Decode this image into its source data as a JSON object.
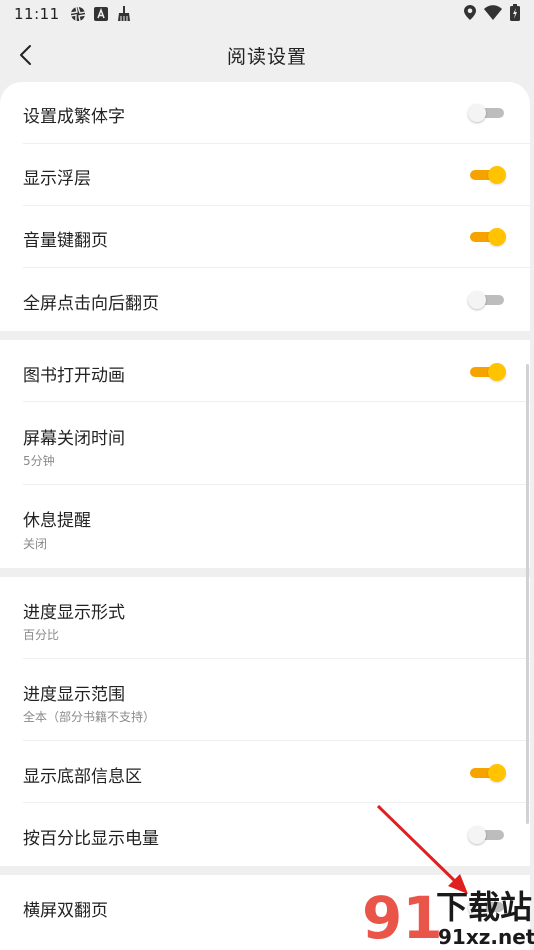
{
  "status_bar": {
    "time": "11:11",
    "icons_left": [
      "aperture-icon",
      "a-box-icon",
      "broom-icon"
    ],
    "icons_right": [
      "location-icon",
      "wifi-icon",
      "battery-charging-icon"
    ]
  },
  "header": {
    "title": "阅读设置",
    "back_icon": "chevron-left-icon"
  },
  "settings": [
    {
      "id": "traditional",
      "label": "设置成繁体字",
      "toggle": false
    },
    {
      "id": "overlay",
      "label": "显示浮层",
      "toggle": true
    },
    {
      "id": "volume-page",
      "label": "音量键翻页",
      "toggle": true
    },
    {
      "id": "fullscreen-tap",
      "label": "全屏点击向后翻页",
      "toggle": false
    },
    {
      "id": "book-animation",
      "label": "图书打开动画",
      "toggle": true
    },
    {
      "id": "screen-off",
      "label": "屏幕关闭时间",
      "value": "5分钟"
    },
    {
      "id": "rest-reminder",
      "label": "休息提醒",
      "value": "关闭"
    },
    {
      "id": "progress-format",
      "label": "进度显示形式",
      "value": "百分比"
    },
    {
      "id": "progress-range",
      "label": "进度显示范围",
      "value": "全本（部分书籍不支持）"
    },
    {
      "id": "bottom-info",
      "label": "显示底部信息区",
      "toggle": true
    },
    {
      "id": "battery-percent",
      "label": "按百分比显示电量",
      "toggle": false
    },
    {
      "id": "landscape-double",
      "label": "横屏双翻页"
    }
  ],
  "colors": {
    "accent": "#ffc300",
    "accent_track": "#f6a300",
    "background": "#efefef",
    "card": "#ffffff",
    "annotation_arrow": "#e02020"
  },
  "watermark": {
    "logo_text": "下载站",
    "logo_url_text": "91xz.net"
  }
}
